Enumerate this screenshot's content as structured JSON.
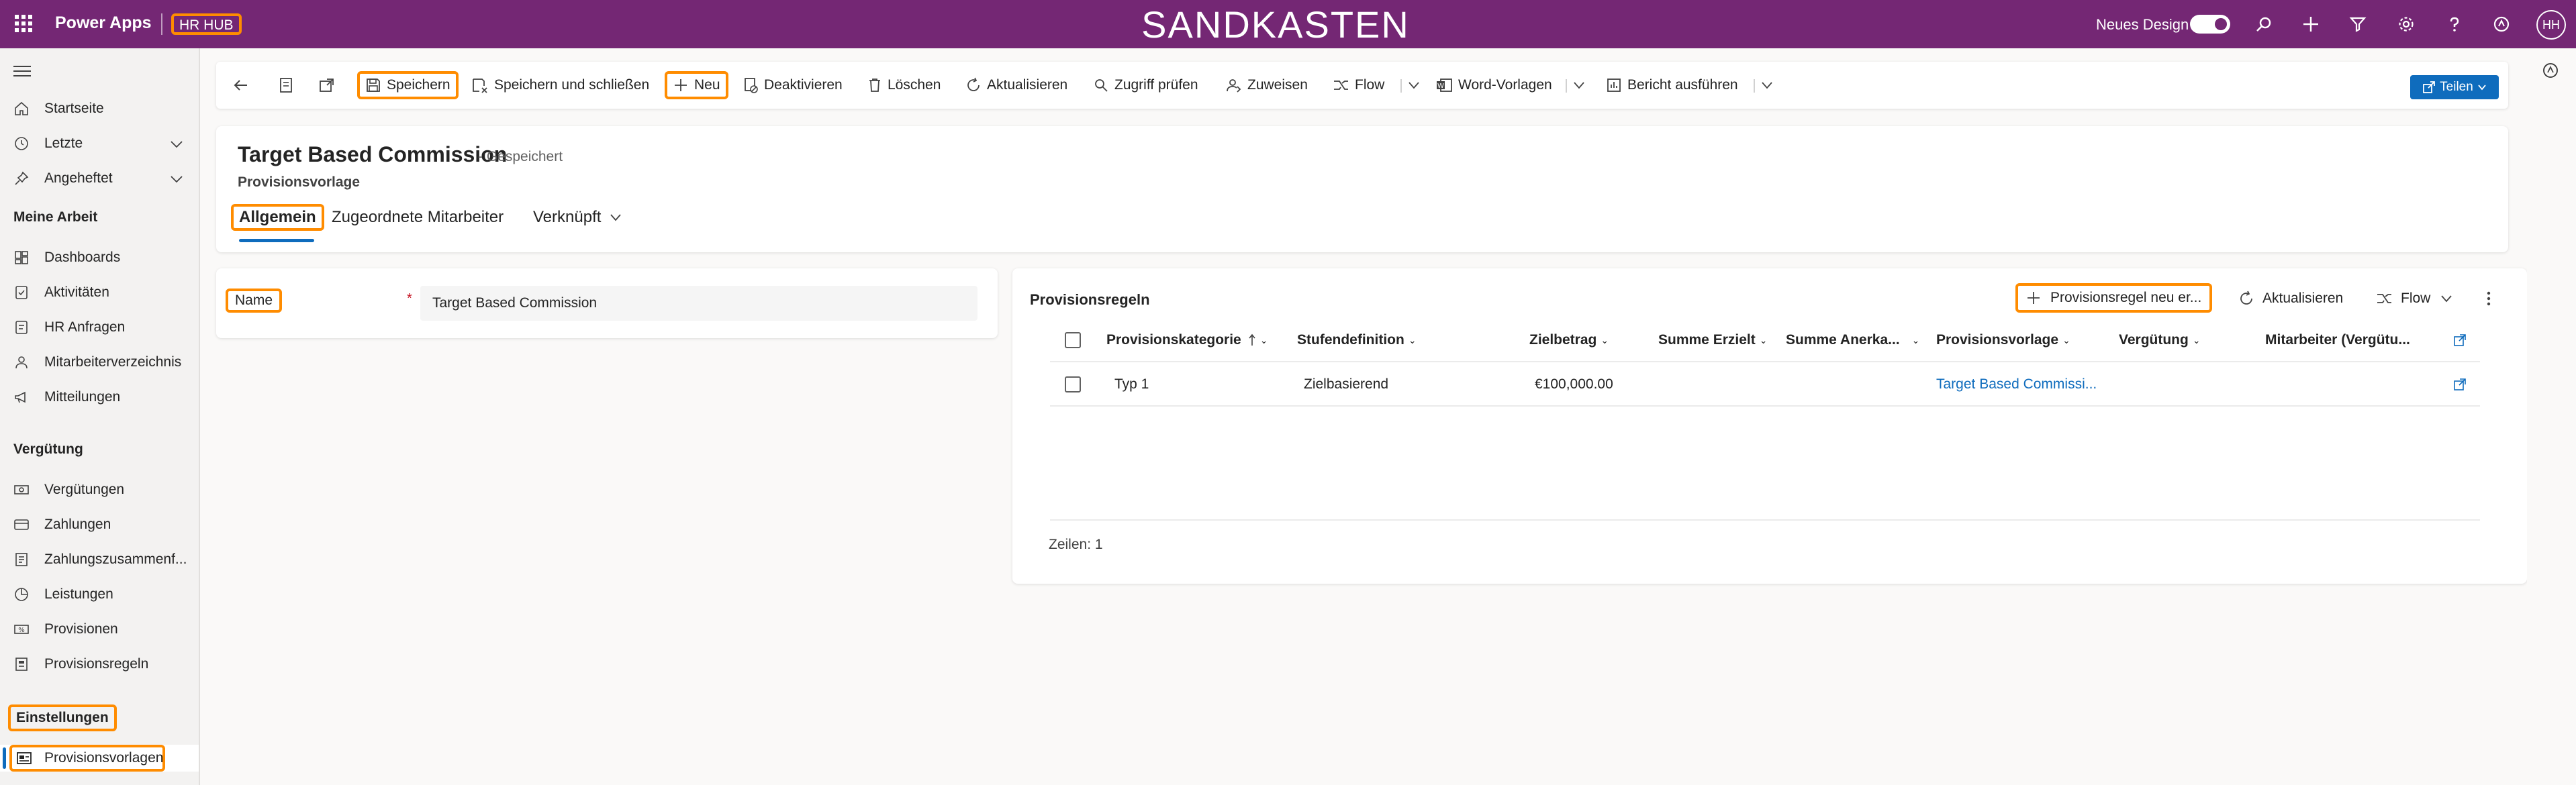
{
  "topbar": {
    "app_name": "Power Apps",
    "hub_name": "HR HUB",
    "environment": "SANDKASTEN",
    "design_label": "Neues Design",
    "avatar_initials": "HH",
    "icons": [
      "search-icon",
      "plus-icon",
      "filter-icon",
      "gear-icon",
      "help-icon",
      "copilot-icon"
    ]
  },
  "sidebar": {
    "top": [
      {
        "label": "Startseite",
        "icon": "home-icon"
      },
      {
        "label": "Letzte",
        "icon": "clock-icon"
      },
      {
        "label": "Angeheftet",
        "icon": "pin-icon"
      }
    ],
    "sections": {
      "my_work": "Meine Arbeit",
      "compensation": "Vergütung",
      "settings": "Einstellungen"
    },
    "my_work": [
      {
        "label": "Dashboards",
        "icon": "dashboard-icon"
      },
      {
        "label": "Aktivitäten",
        "icon": "activity-icon"
      },
      {
        "label": "HR Anfragen",
        "icon": "request-icon"
      },
      {
        "label": "Mitarbeiterverzeichnis",
        "icon": "person-icon"
      },
      {
        "label": "Mitteilungen",
        "icon": "megaphone-icon"
      }
    ],
    "compensation": [
      {
        "label": "Vergütungen",
        "icon": "money-icon"
      },
      {
        "label": "Zahlungen",
        "icon": "payment-icon"
      },
      {
        "label": "Zahlungszusammenf...",
        "icon": "summary-icon"
      },
      {
        "label": "Leistungen",
        "icon": "pie-icon"
      },
      {
        "label": "Provisionen",
        "icon": "commission-icon"
      },
      {
        "label": "Provisionsregeln",
        "icon": "rules-icon"
      }
    ],
    "settings": [
      {
        "label": "Provisionsvorlagen",
        "icon": "template-icon",
        "selected": true
      }
    ]
  },
  "commandbar": {
    "save": "Speichern",
    "save_close": "Speichern und schließen",
    "new": "Neu",
    "deactivate": "Deaktivieren",
    "delete": "Löschen",
    "refresh": "Aktualisieren",
    "check_access": "Zugriff prüfen",
    "assign": "Zuweisen",
    "flow": "Flow",
    "word_templates": "Word-Vorlagen",
    "run_report": "Bericht ausführen",
    "share": "Teilen"
  },
  "header": {
    "title": "Target Based Commission",
    "saved_status": "- Gespeichert",
    "entity": "Provisionsvorlage",
    "tabs": [
      "Allgemein",
      "Zugeordnete Mitarbeiter",
      "Verknüpft"
    ]
  },
  "form": {
    "name_label": "Name",
    "required_marker": "*",
    "name_value": "Target Based Commission"
  },
  "subgrid": {
    "title": "Provisionsregeln",
    "new_button": "Provisionsregel neu er...",
    "refresh": "Aktualisieren",
    "flow": "Flow",
    "columns": [
      "Provisionskategorie",
      "Stufendefinition",
      "Zielbetrag",
      "Summe Erzielt",
      "Summe Anerka...",
      "Provisionsvorlage",
      "Vergütung",
      "Mitarbeiter (Vergütu..."
    ],
    "rows": [
      {
        "kategorie": "Typ 1",
        "stufe": "Zielbasierend",
        "ziel": "€100,000.00",
        "erzielt": "",
        "anerkannt": "",
        "vorlage": "Target Based Commissi...",
        "verguetung": "",
        "mitarbeiter": ""
      }
    ],
    "row_count": "Zeilen: 1"
  },
  "colors": {
    "brand": "#742774",
    "highlight": "#ff8c00",
    "accent": "#0f6cbd"
  }
}
